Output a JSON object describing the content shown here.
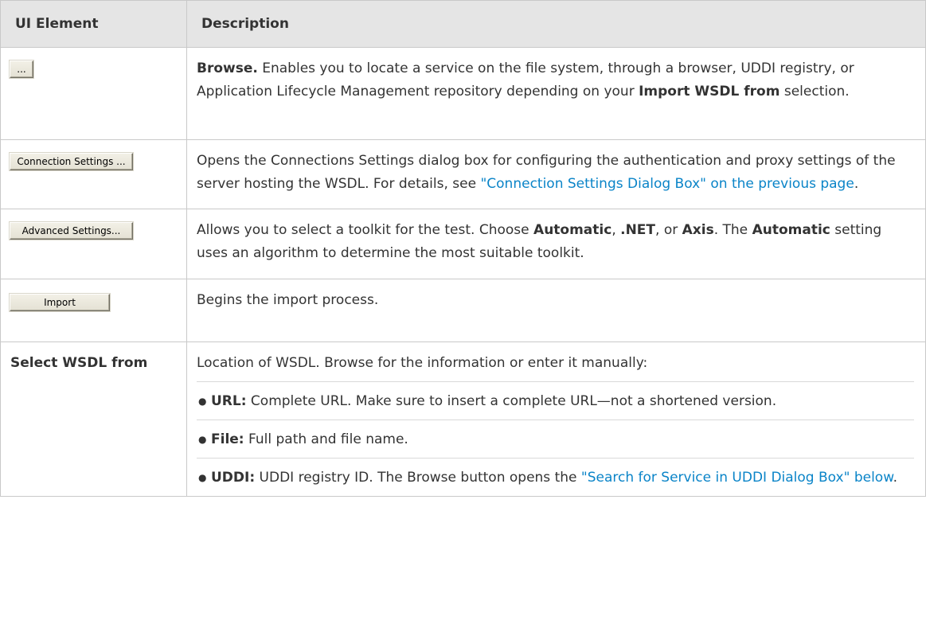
{
  "table": {
    "headers": {
      "ui_element": "UI Element",
      "description": "Description"
    },
    "rows": [
      {
        "button": "...",
        "description": {
          "bold": "Browse.",
          "text1": " Enables you to locate a service on the file system, through a browser, UDDI registry, or Application Lifecycle Management repository depending on your ",
          "bold2": "Import WSDL from",
          "text2": " selection."
        }
      },
      {
        "button": "Connection Settings ...",
        "description": {
          "text1": "Opens the Connections Settings dialog box for configuring the authentication and proxy settings of the server hosting the WSDL. For details, see ",
          "link": "\"Connection Settings Dialog Box\" on the previous page",
          "text2": "."
        }
      },
      {
        "button": "Advanced Settings...",
        "description": {
          "text1": "Allows you to select a toolkit for the test. Choose ",
          "b1": "Automatic",
          "sep1": ", ",
          "b2": ".NET",
          "sep2": ", or ",
          "b3": "Axis",
          "sep3": ". The ",
          "b4": "Automatic",
          "text2": " setting uses an algorithm to determine the most suitable toolkit."
        }
      },
      {
        "button": "Import",
        "description": {
          "text1": "Begins the import process."
        }
      },
      {
        "label": "Select WSDL from",
        "description": {
          "intro": "Location of WSDL. Browse for the information or enter it manually:",
          "items": [
            {
              "bold": "URL:",
              "text": " Complete URL. Make sure to insert a complete URL—not a shortened version."
            },
            {
              "bold": "File:",
              "text": " Full path and file name."
            },
            {
              "bold": "UDDI:",
              "text": " UDDI registry ID. The Browse button opens the ",
              "link": "\"Search for Service in UDDI Dialog Box\" below",
              "text2": "."
            }
          ]
        }
      }
    ]
  },
  "colors": {
    "header_bg": "#e5e5e5",
    "border": "#c9c9c9",
    "link": "#0a84c8",
    "text": "#333333"
  }
}
